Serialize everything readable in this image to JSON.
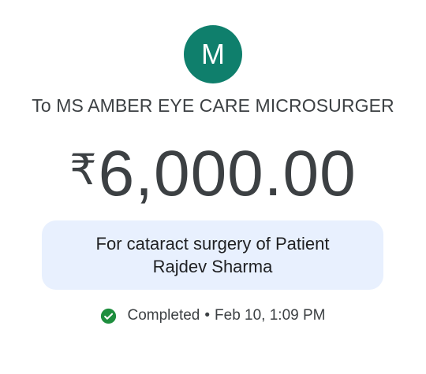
{
  "payment": {
    "avatar_letter": "M",
    "recipient": "To MS AMBER EYE CARE MICROSURGER",
    "currency_symbol": "₹",
    "amount": "6,000.00",
    "note": "For cataract surgery of Patient Rajdev Sharma",
    "status": {
      "state": "Completed",
      "separator": "•",
      "timestamp": "Feb 10, 1:09 PM",
      "icon": "check-circle-icon"
    }
  },
  "colors": {
    "avatar_bg": "#0f7f6c",
    "note_bg": "#e8f0fe",
    "status_green": "#1e8e3e"
  }
}
